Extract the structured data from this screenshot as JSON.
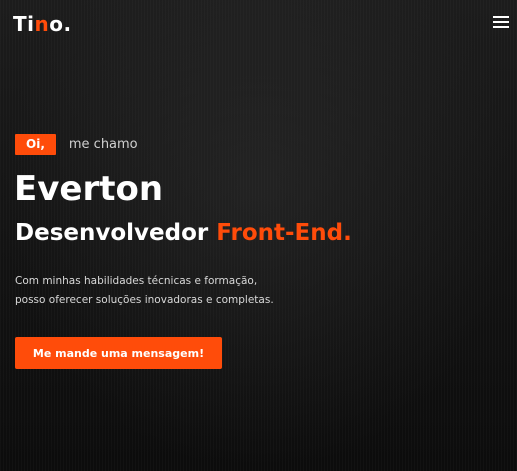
{
  "header": {
    "logo_part1": "Ti",
    "logo_accent": "n",
    "logo_part2": "o.",
    "menu_icon": "hamburger-menu-icon"
  },
  "hero": {
    "greeting_badge": "Oi,",
    "greeting_text": "me chamo",
    "name": "Everton",
    "role_main": "Desenvolvedor",
    "role_accent": "Front-End.",
    "description_line1": "Com minhas habilidades técnicas e formação,",
    "description_line2": "posso oferecer soluções inovadoras e completas.",
    "cta_label": "Me mande uma mensagem!"
  },
  "colors": {
    "accent": "#ff4c0a",
    "background": "#141414",
    "text": "#ffffff"
  }
}
